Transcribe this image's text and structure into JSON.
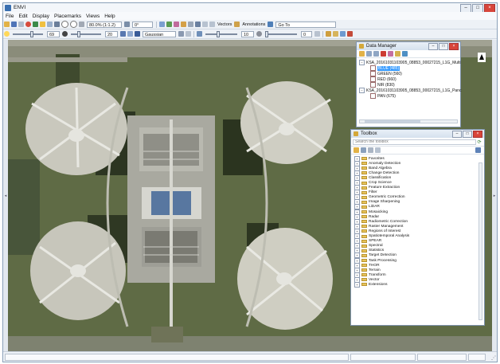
{
  "app": {
    "title": "ENVI"
  },
  "menu": [
    "File",
    "Edit",
    "Display",
    "Placemarks",
    "Views",
    "Help"
  ],
  "toolbar": {
    "zoom_value": "80.0% (1:1.2)",
    "rotation_value": "0°",
    "vectors_label": "Vectors",
    "annotations_label": "Annotations",
    "goto_label": "Go To",
    "brightness_value": "69",
    "contrast_value": "20",
    "stretch_value": "Gaussian",
    "sharpen_value": "10",
    "transparency_value": "0"
  },
  "data_manager": {
    "title": "Data Manager",
    "files": [
      {
        "name": "KSA_20161031103905_08853_00027215_L1G_Multi",
        "bands": [
          {
            "label": "BLUE (485)",
            "selected": true
          },
          {
            "label": "GREEN (560)",
            "selected": false
          },
          {
            "label": "RED (660)",
            "selected": false
          },
          {
            "label": "NIR (830)",
            "selected": false
          }
        ]
      },
      {
        "name": "KSA_20161031103905_08853_00027215_L1G_Panc",
        "bands": [
          {
            "label": "PAN (675)",
            "selected": false
          }
        ]
      }
    ]
  },
  "toolbox": {
    "title": "Toolbox",
    "search_placeholder": "Search the toolbox",
    "items": [
      "Favorites",
      "Anomaly Detection",
      "Band Algebra",
      "Change Detection",
      "Classification",
      "Crop Science",
      "Feature Extraction",
      "Filter",
      "Geometric Correction",
      "Image Sharpening",
      "LiDAR",
      "Mosaicking",
      "Radar",
      "Radiometric Correction",
      "Raster Management",
      "Regions of Interest",
      "Spatiotemporal Analysis",
      "SPEAR",
      "Spectral",
      "Statistics",
      "Target Detection",
      "Task Processing",
      "THOR",
      "Terrain",
      "Transform",
      "Vector",
      "Extensions"
    ]
  },
  "icons": [
    "folder-icon",
    "save-icon",
    "pin-icon",
    "zoom-in-icon",
    "zoom-out-icon",
    "pan-icon",
    "select-icon",
    "cursor-icon",
    "rotate-icon",
    "vector-icon",
    "annotation-icon",
    "goto-icon",
    "refresh-icon",
    "north-arrow-icon"
  ],
  "colors": {
    "accent": "#3399ff",
    "folder": "#e7c35a",
    "title_gradient_top": "#e9f0f8"
  }
}
